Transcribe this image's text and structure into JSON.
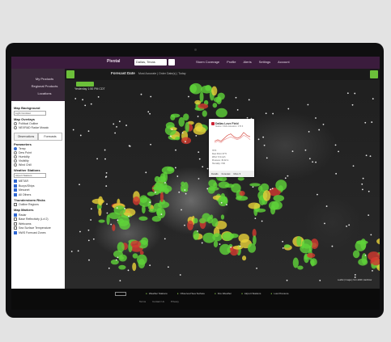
{
  "topbar": {
    "brand": "Pivotal",
    "location": "Dallas, Texas",
    "nav": [
      "Storm Coverage",
      "Profile",
      "Alerts",
      "Settings",
      "Account"
    ]
  },
  "sidebar": {
    "nav": [
      "My Products",
      "Regional Products",
      "Locations"
    ],
    "map_background_label": "Map Background",
    "map_background_value": "Light Contrast",
    "map overlays": "",
    "overlays_label": "Map Overlays",
    "overlay_options": [
      {
        "label": "Political Outline",
        "on": false
      },
      {
        "label": "NEXRAD Radar Mosaic",
        "on": false
      }
    ],
    "tabs": [
      "Observations",
      "Forecasts"
    ],
    "parameters_label": "Parameters",
    "parameters": [
      {
        "label": "Temp",
        "on": true
      },
      {
        "label": "Dew Point",
        "on": false
      },
      {
        "label": "Humidity",
        "on": false
      },
      {
        "label": "Visibility",
        "on": false
      },
      {
        "label": "Wind Chill",
        "on": false
      }
    ],
    "stations_label": "Weather Stations",
    "stations_value": "Airport Stations",
    "station_types": [
      {
        "label": "METAR",
        "on": true
      },
      {
        "label": "Buoys/Ships",
        "on": true
      },
      {
        "label": "Mesonet",
        "on": true
      },
      {
        "label": "All Others",
        "on": true
      }
    ],
    "thunderstorm_label": "Thunderstorm Risks",
    "thunderstorm_option": "Outline Regions",
    "map_markers_label": "Map Markers",
    "markers": [
      {
        "label": "Radar",
        "on": true
      },
      {
        "label": "Base Reflectivity (Lvl 2)",
        "on": false
      },
      {
        "label": "Webcams",
        "on": false
      },
      {
        "label": "Sea Surface Temperature",
        "on": false
      },
      {
        "label": "NWS Forecast Zones",
        "on": true
      }
    ]
  },
  "map": {
    "forecast_label": "Forecast Date",
    "forecast_sub": "Most Accurate | Order Date(s) | Today",
    "time_text": "Yesterday 1:50 PM CDT",
    "scale_text": "Leaflet | Imagery from ESRI, Earthstar"
  },
  "popup": {
    "title": "Dallas Love Field",
    "subtitle": "Station: KDAL Elevation: 479 ft",
    "meta": [
      "76°F",
      "Dew Point: 67°F",
      "Wind: S 9 mph",
      "Pressure: 30.02 in",
      "Humidity: 74%"
    ],
    "footer": [
      "Details",
      "Forecast",
      "More ▾"
    ]
  },
  "chart_data": {
    "type": "line",
    "series": [
      {
        "values": [
          3,
          4,
          3,
          5,
          7,
          8,
          6,
          5,
          6,
          9,
          7,
          6
        ]
      },
      {
        "values": [
          2,
          3,
          2,
          4,
          5,
          6,
          5,
          4,
          5,
          7,
          6,
          4
        ]
      }
    ],
    "ylim": [
      0,
      10
    ]
  },
  "bottombar": {
    "legend": [
      "Weather Stations",
      "Observed Sea Surface",
      "Fire Weather",
      "Airport Stations",
      "Low Pressure"
    ],
    "links": [
      "Terms",
      "Contact Us",
      "Privacy"
    ]
  },
  "colors": {
    "purple": "#3b1c3d",
    "green": "#6cbf3a",
    "radar_green": "#5fd33a",
    "radar_yellow": "#e8d23a",
    "radar_red": "#d23a2f"
  }
}
